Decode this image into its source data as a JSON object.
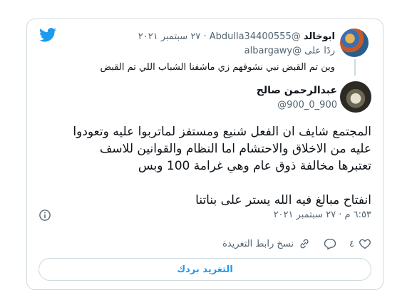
{
  "reply_tweet": {
    "author_name": "ابوخالد",
    "handle": "@Abdulla34400555",
    "separator": "·",
    "date": "٢٧ سبتمبر ٢٠٢١",
    "replying_to_prefix": "ردًا على",
    "replying_to_handle": "@albargawy",
    "text": "وين تم القبض نبي نشوفهم زي ماشفنا الشباب اللي تم القبض"
  },
  "main_tweet": {
    "author_name": "عبدالرحمن صالح",
    "handle": "@900_0_900",
    "text_lines": [
      "المجتمع شايف ان الفعل شنيع ومستفز لماتربوا عليه وتعودوا",
      "عليه من الاخلاق والاحتشام اما النظام والقوانين للاسف",
      "تعتبرها مخالفة ذوق عام وهي غرامة 100 وبس"
    ],
    "text_line_last": "انفتاح مبالغ فيه الله يستر على بناتنا",
    "timestamp": "٦:٥٣ م · ٢٧ سبتمبر ٢٠٢١"
  },
  "actions": {
    "like_count": "٤",
    "copy_link_label": "نسخ رابط التغريدة"
  },
  "read_reply_label": "التغريد بردك",
  "colors": {
    "twitter_blue": "#1d9bf0",
    "text_primary": "#0f1419",
    "text_secondary": "#536471",
    "border": "#cfd9de"
  },
  "icons": [
    "twitter-logo-icon",
    "info-icon",
    "heart-icon",
    "reply-icon",
    "link-icon"
  ]
}
